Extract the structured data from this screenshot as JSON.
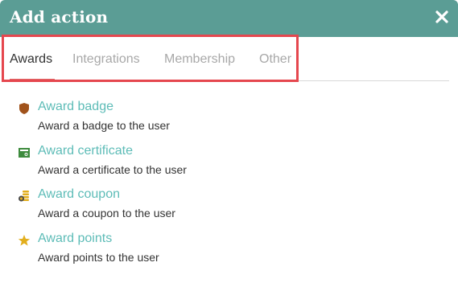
{
  "dialog": {
    "title": "Add action",
    "close_icon": "close-icon"
  },
  "tabs": [
    {
      "label": "Awards",
      "active": true
    },
    {
      "label": "Integrations",
      "active": false
    },
    {
      "label": "Membership",
      "active": false
    },
    {
      "label": "Other",
      "active": false
    }
  ],
  "actions": [
    {
      "label": "Award badge",
      "description": "Award a badge to the user",
      "icon": "badge-shield-icon"
    },
    {
      "label": "Award certificate",
      "description": "Award a certificate to the user",
      "icon": "certificate-icon"
    },
    {
      "label": "Award coupon",
      "description": "Award a coupon to the user",
      "icon": "coupon-coins-icon"
    },
    {
      "label": "Award points",
      "description": "Award points to the user",
      "icon": "star-icon"
    }
  ],
  "colors": {
    "header": "#5b9d95",
    "link": "#5dbcb7",
    "active_tab_underline": "#e06a6a",
    "highlight_box": "#e5474e",
    "badge_icon": "#a0521b",
    "certificate_icon": "#3d8b3d",
    "coupon_icon": "#e2ae1c",
    "star_icon": "#e2ae1c"
  }
}
